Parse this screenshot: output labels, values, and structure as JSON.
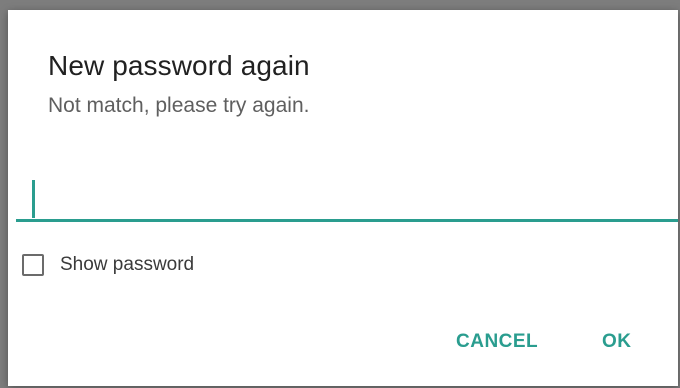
{
  "dialog": {
    "title": "New password again",
    "message": "Not match, please try again.",
    "input": {
      "value": "",
      "placeholder": ""
    },
    "show_password": {
      "label": "Show password",
      "checked": false
    },
    "buttons": {
      "cancel": "CANCEL",
      "ok": "OK"
    }
  },
  "colors": {
    "accent": "#2a9d8f",
    "title_text": "#212121",
    "message_text": "#5f5f5f",
    "dialog_bg": "#ffffff"
  }
}
